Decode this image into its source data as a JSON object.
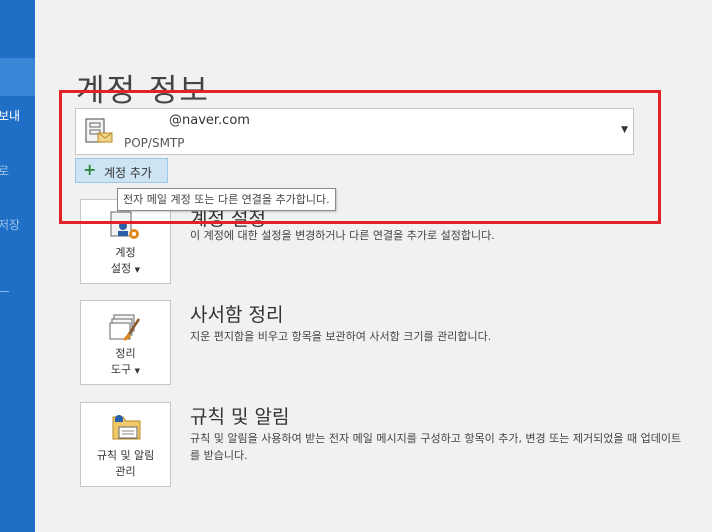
{
  "rail": {
    "items": [
      {
        "label": "보내",
        "state": "active"
      },
      {
        "label": "로",
        "state": "dim"
      },
      {
        "label": "저장",
        "state": "dim"
      }
    ]
  },
  "page_title": "계정 정보",
  "account": {
    "email": "@naver.com",
    "type": "POP/SMTP"
  },
  "add_account_label": "계정 추가",
  "tooltip": "전자 메일 계정 또는 다른 연결을 추가합니다.",
  "sections": [
    {
      "tile_line1": "계정",
      "tile_line2": "설정",
      "title": "계정 설정",
      "desc": "이 계정에 대한 설정을 변경하거나 다른 연결을 추가로 설정합니다."
    },
    {
      "tile_line1": "정리",
      "tile_line2": "도구",
      "title": "사서함 정리",
      "desc": "지운 편지함을 비우고 항목을 보관하여 사서함 크기를 관리합니다."
    },
    {
      "tile_line1": "규칙 및 알림",
      "tile_line2": "관리",
      "title": "규칙 및 알림",
      "desc": "규칙 및 알림을 사용하여 받는 전자 메일 메시지를 구성하고 항목이 추가, 변경 또는 제거되었을 때 업데이트를 받습니다."
    }
  ],
  "colors": {
    "rail": "#1e6fc5",
    "highlight": "#e0222a",
    "add_button_bg": "#cde4f5"
  }
}
